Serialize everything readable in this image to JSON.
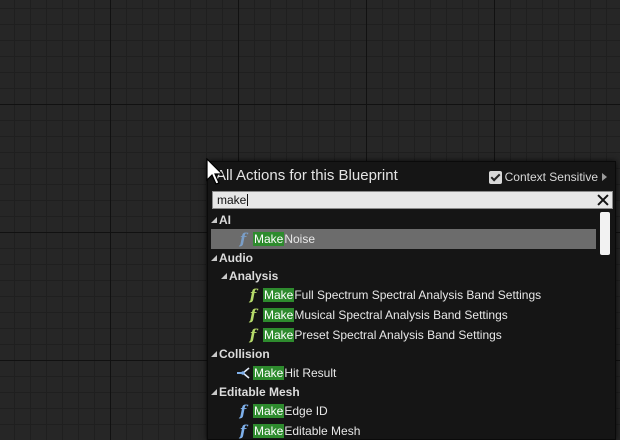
{
  "panel": {
    "title": "All Actions for this Blueprint",
    "context_sensitive": {
      "label": "Context Sensitive",
      "checked": true
    }
  },
  "search": {
    "value": "make"
  },
  "tree": {
    "highlight_text": "Make",
    "rows": [
      {
        "kind": "category",
        "label": "AI"
      },
      {
        "kind": "item",
        "icon": "function-icon",
        "rest": " Noise",
        "selected": true
      },
      {
        "kind": "category",
        "label": "Audio"
      },
      {
        "kind": "category",
        "label": "Analysis"
      },
      {
        "kind": "item",
        "icon": "function-icon",
        "rest": " Full Spectrum Spectral Analysis Band Settings"
      },
      {
        "kind": "item",
        "icon": "function-icon",
        "rest": " Musical Spectral Analysis Band Settings"
      },
      {
        "kind": "item",
        "icon": "function-icon",
        "rest": " Preset Spectral Analysis Band Settings"
      },
      {
        "kind": "category",
        "label": "Collision"
      },
      {
        "kind": "item",
        "icon": "make-struct-icon",
        "rest": " Hit Result"
      },
      {
        "kind": "category",
        "label": "Editable Mesh"
      },
      {
        "kind": "item",
        "icon": "function-icon",
        "rest": " Edge ID"
      },
      {
        "kind": "item",
        "icon": "function-icon",
        "rest": " Editable Mesh"
      }
    ]
  },
  "colors": {
    "match_highlight": "#2e8b2e",
    "selected_row": "#6c6c6c",
    "panel_bg": "#151515",
    "graph_bg": "#262626"
  }
}
